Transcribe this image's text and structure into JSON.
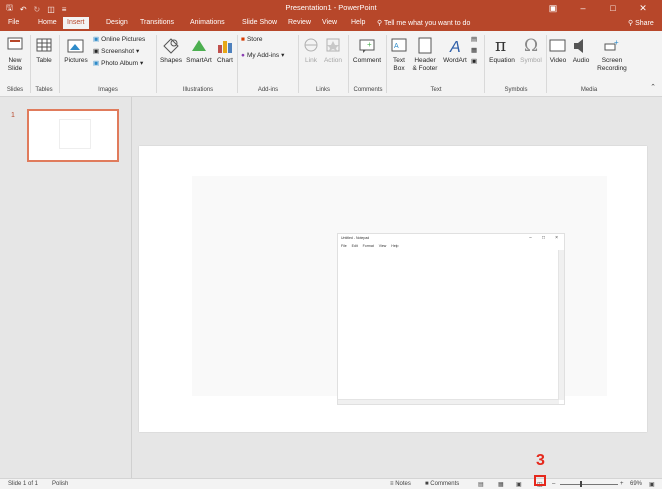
{
  "titlebar": {
    "title": "Presentation1 - PowerPoint",
    "qat": [
      "save-icon",
      "undo-icon",
      "redo-icon",
      "start-from-beginning-icon",
      "customize-icon"
    ],
    "window_buttons": [
      "ribbon-display-icon",
      "minimize-icon",
      "restore-icon",
      "close-icon"
    ]
  },
  "tabs": {
    "items": [
      "File",
      "Home",
      "Insert",
      "Design",
      "Transitions",
      "Animations",
      "Slide Show",
      "Review",
      "View",
      "Help"
    ],
    "active": "Insert",
    "tell_me": "Tell me what you want to do",
    "share": "Share"
  },
  "ribbon": {
    "slides": {
      "new_slide": "New",
      "new_slide2": "Slide",
      "group": "Slides"
    },
    "tables": {
      "table": "Table",
      "group": "Tables"
    },
    "images": {
      "pictures": "Pictures",
      "online_pictures": "Online Pictures",
      "screenshot": "Screenshot",
      "photo_album": "Photo Album",
      "group": "Images"
    },
    "illustrations": {
      "shapes": "Shapes",
      "smartart": "SmartArt",
      "chart": "Chart",
      "group": "Illustrations"
    },
    "addins": {
      "store": "Store",
      "my_addins": "My Add-ins",
      "group": "Add-ins"
    },
    "links": {
      "link": "Link",
      "action": "Action",
      "group": "Links"
    },
    "comments": {
      "comment": "Comment",
      "group": "Comments"
    },
    "text": {
      "text_box1": "Text",
      "text_box2": "Box",
      "header1": "Header",
      "header2": "& Footer",
      "wordart": "WordArt",
      "group": "Text"
    },
    "symbols": {
      "equation": "Equation",
      "symbol": "Symbol",
      "group": "Symbols"
    },
    "media": {
      "video": "Video",
      "audio": "Audio",
      "screen1": "Screen",
      "screen2": "Recording",
      "group": "Media"
    }
  },
  "thumbnails": {
    "slide_number": "1"
  },
  "embedded_window": {
    "title": "Untitled - Notepad",
    "menu": [
      "File",
      "Edit",
      "Format",
      "View",
      "Help"
    ],
    "buttons": [
      "−",
      "□",
      "×"
    ]
  },
  "status": {
    "slide_info": "Slide 1 of 1",
    "language": "Polish",
    "notes": "Notes",
    "comments": "Comments",
    "zoom": "69%"
  },
  "callout": {
    "number": "3",
    "color": "#e5281c"
  },
  "colors": {
    "accent": "#b7472a"
  }
}
